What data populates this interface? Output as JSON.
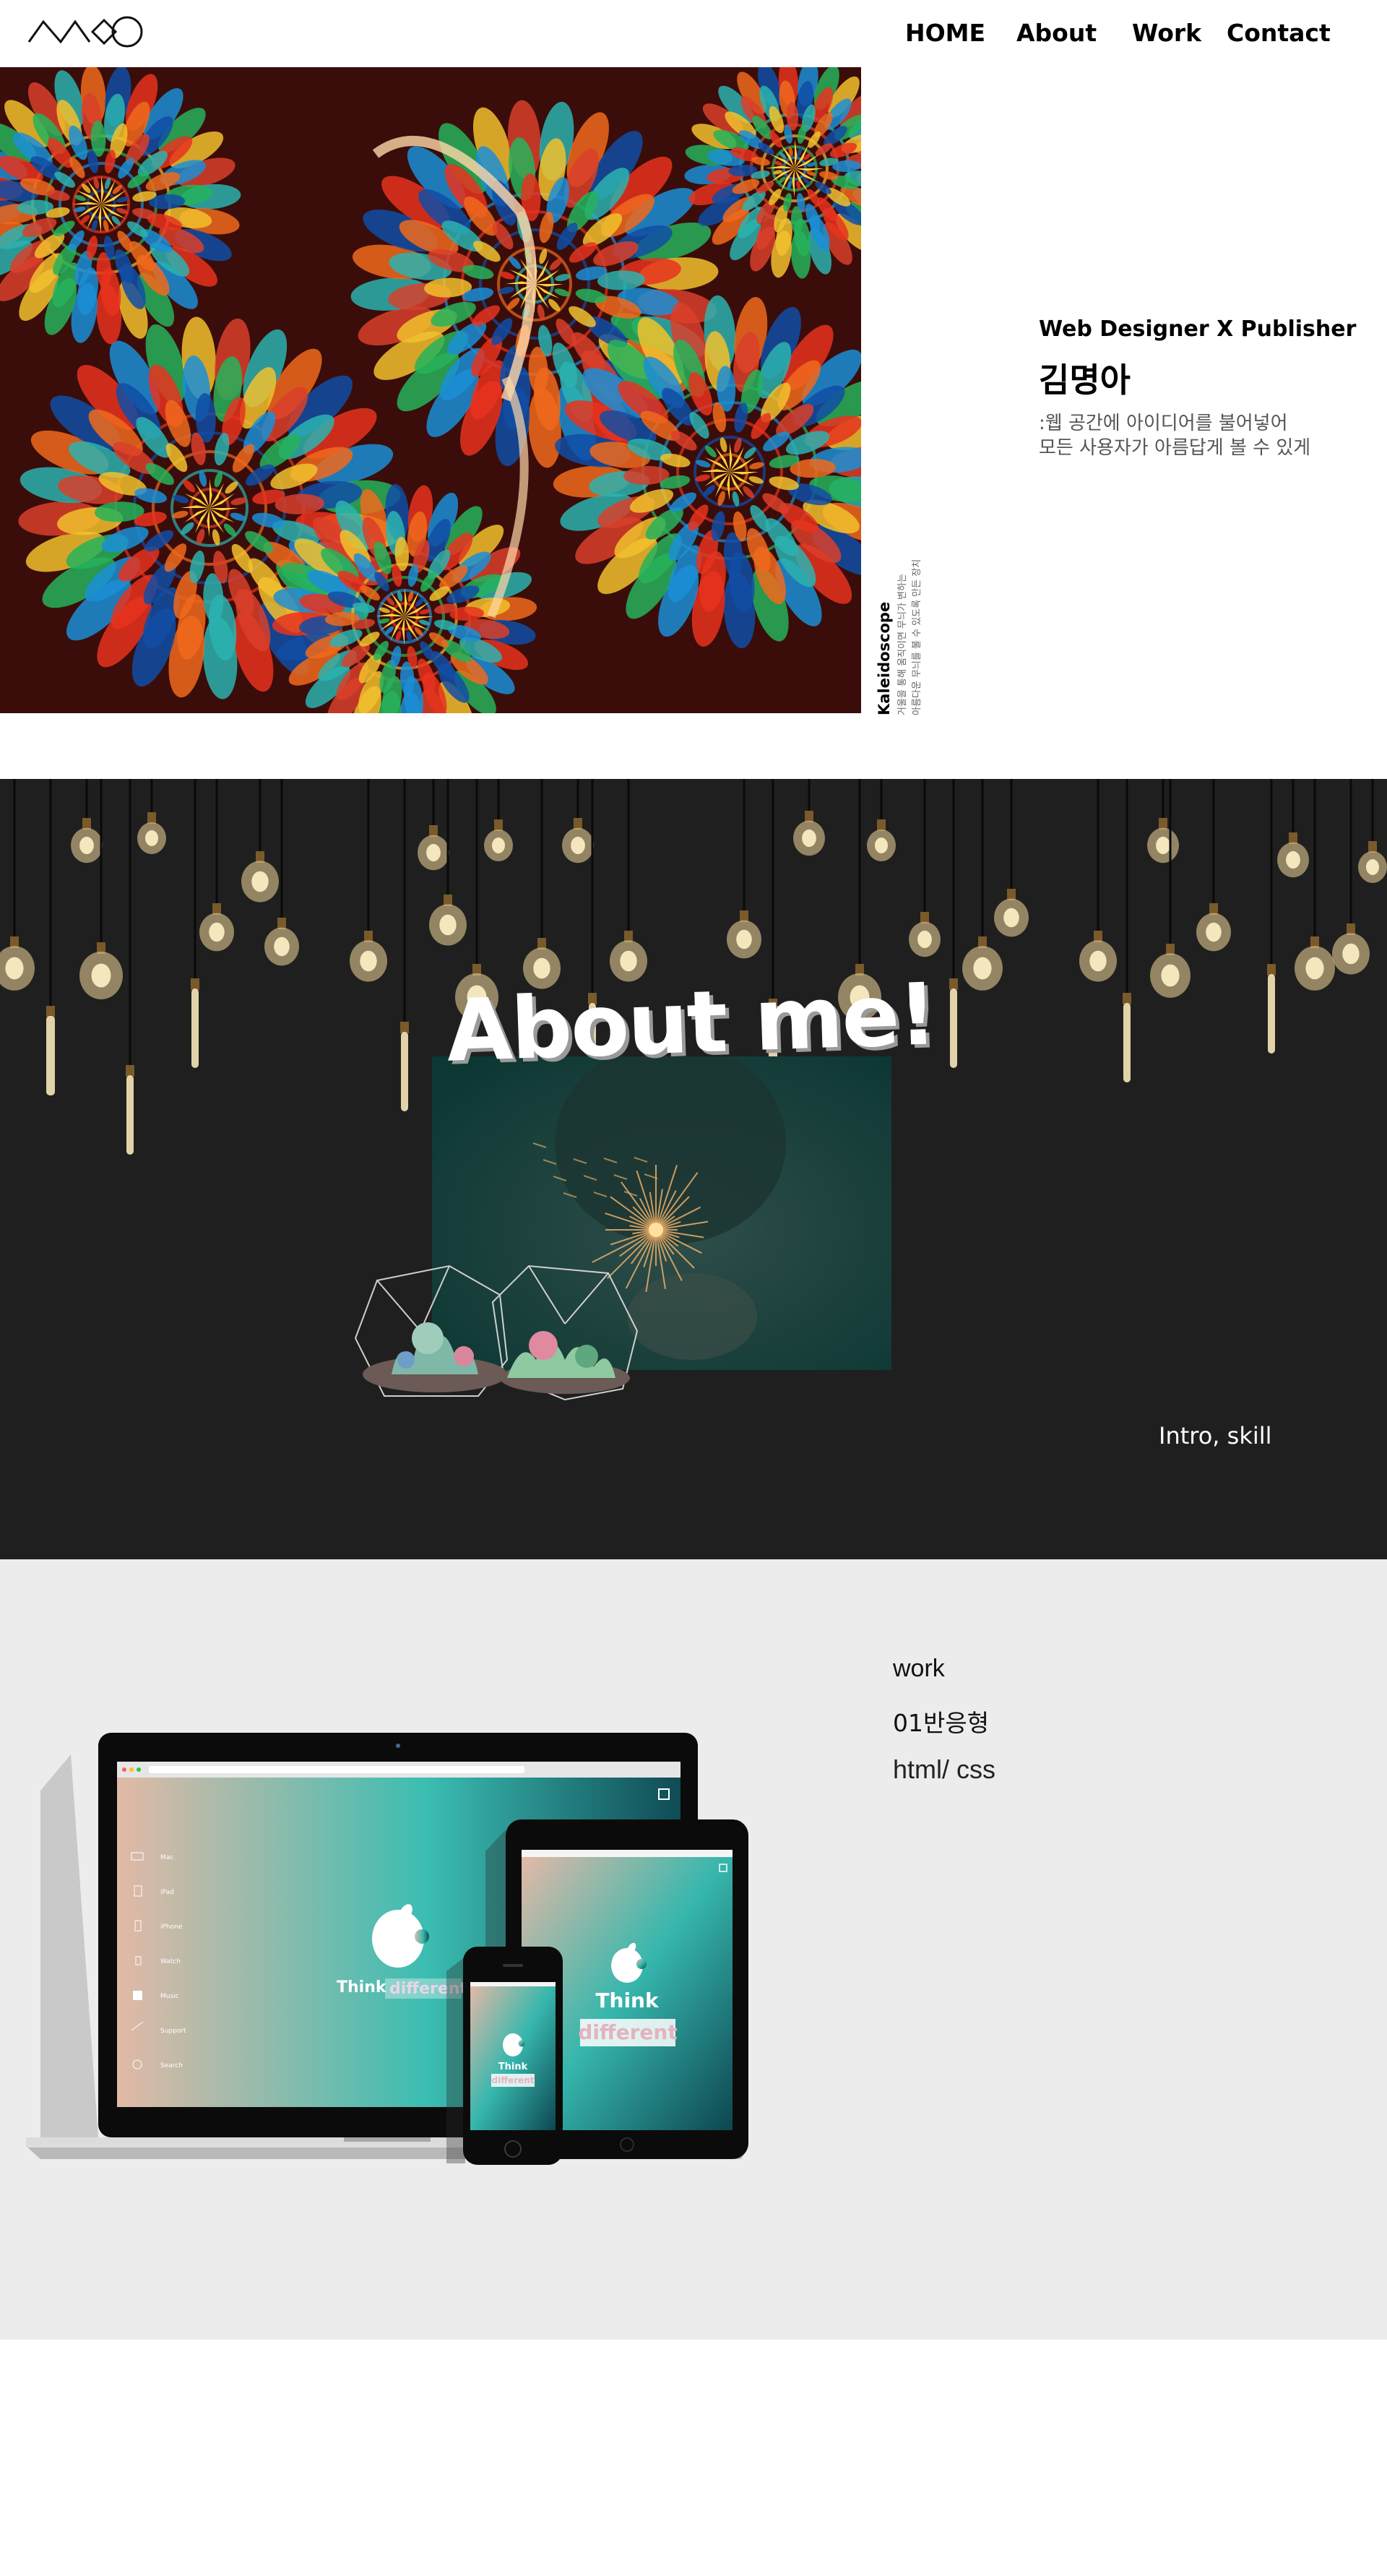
{
  "header": {
    "logo": "logo-icon",
    "nav": [
      {
        "label": "HOME"
      },
      {
        "label": "About"
      },
      {
        "label": "Work"
      },
      {
        "label": "Contact"
      }
    ]
  },
  "hero": {
    "image": "kaleidoscope-photo",
    "title": "Web Designer X Publisher",
    "name": "김명아",
    "description_lines": [
      ":웹 공간에 아이디어를 불어넣어",
      "모든 사용자가 아름답게 볼 수 있게"
    ],
    "vertical_title": "Kaleidoscope",
    "vertical_desc_lines": [
      "거울을 통해 움직이면 무늬가 변하는",
      "아름다운 무늬를 볼 수 있도록 만든 장치"
    ]
  },
  "about": {
    "background": "#1f1f1f",
    "heading": "About me!",
    "link": "Intro, skill"
  },
  "work": {
    "background": "#ececec",
    "label": "work",
    "number": "01반응형",
    "tech": "html/ css",
    "mockup": {
      "laptop_slogan_1": "Think",
      "laptop_slogan_2": "different",
      "tablet_slogan_1": "Think",
      "tablet_slogan_2": "different",
      "phone_slogan_1": "Think",
      "phone_slogan_2": "different",
      "sidebar_items": [
        "Mac",
        "iPad",
        "iPhone",
        "Watch",
        "Music",
        "Support",
        "Search"
      ]
    }
  }
}
